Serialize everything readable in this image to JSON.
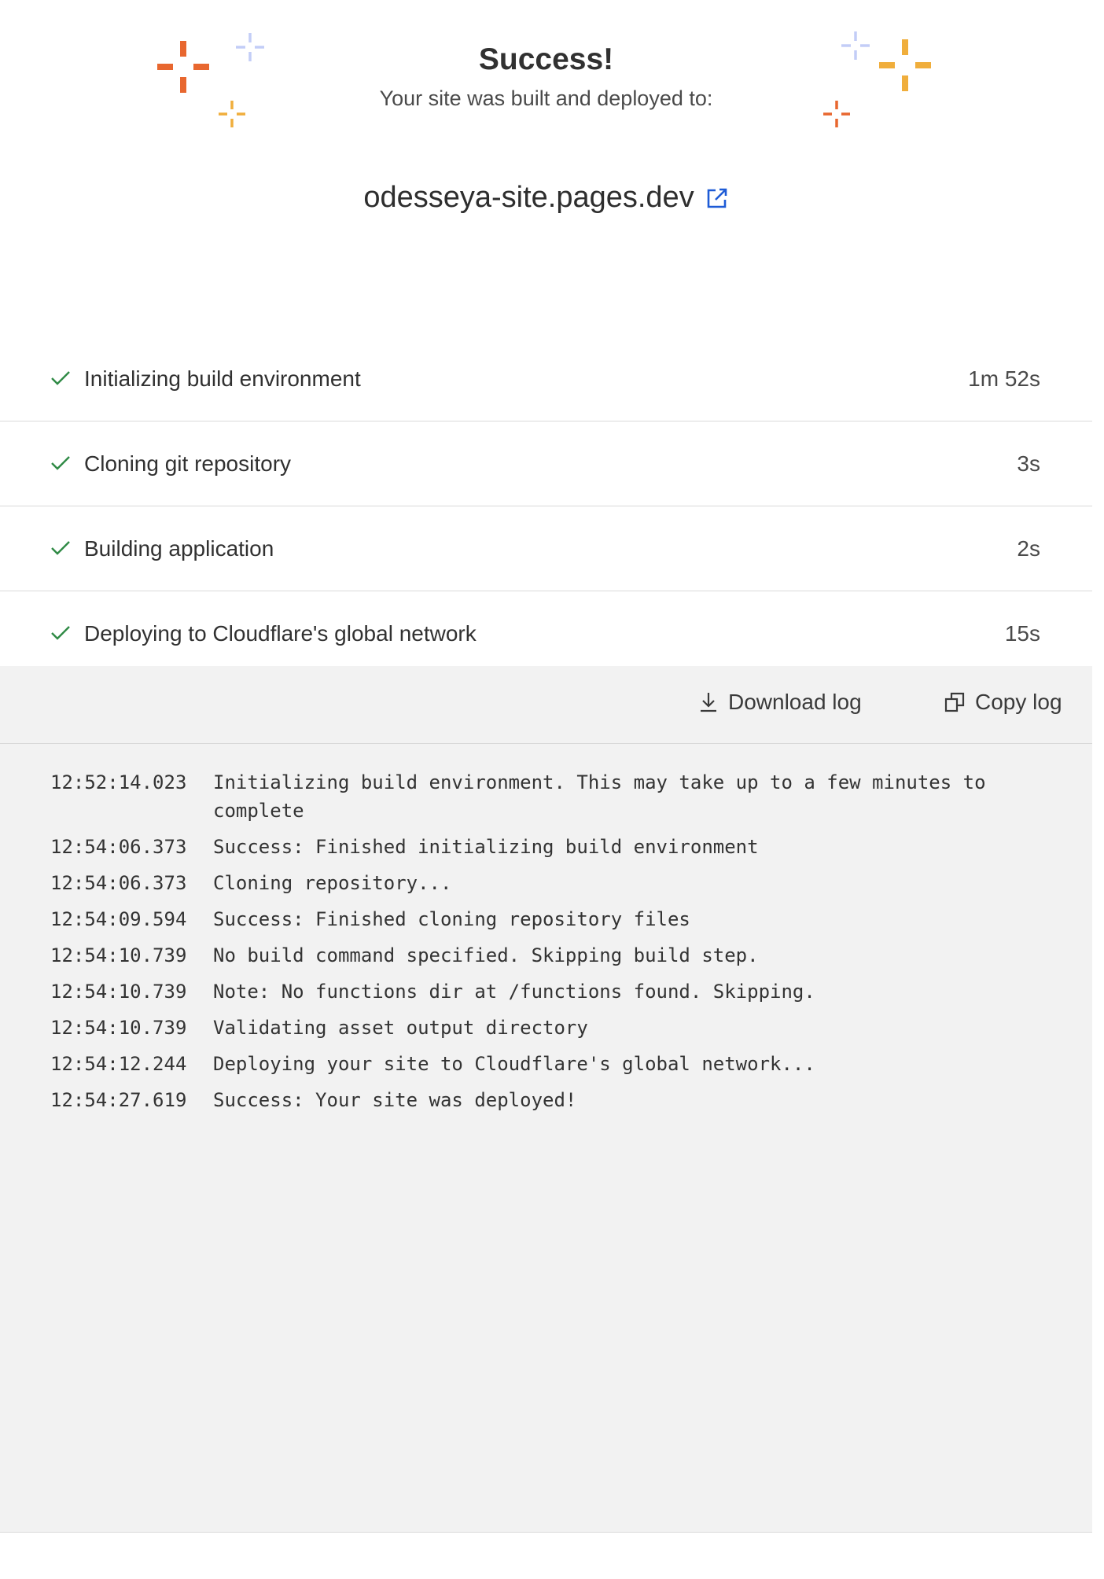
{
  "header": {
    "title": "Success!",
    "subtitle": "Your site was built and deployed to:",
    "site_url": "odesseya-site.pages.dev",
    "colors": {
      "orange": "#e8672f",
      "yellow": "#f0ae3c",
      "light_blue": "#c3cdf7",
      "link_icon": "#1e5bd6"
    }
  },
  "steps": [
    {
      "label": "Initializing build environment",
      "duration": "1m 52s",
      "status": "success"
    },
    {
      "label": "Cloning git repository",
      "duration": "3s",
      "status": "success"
    },
    {
      "label": "Building application",
      "duration": "2s",
      "status": "success"
    },
    {
      "label": "Deploying to Cloudflare's global network",
      "duration": "15s",
      "status": "success"
    }
  ],
  "toolbar": {
    "download_label": "Download log",
    "copy_label": "Copy log"
  },
  "log": [
    {
      "time": "12:52:14.023",
      "message": "Initializing build environment. This may take up to a few minutes to complete"
    },
    {
      "time": "12:54:06.373",
      "message": "Success: Finished initializing build environment"
    },
    {
      "time": "12:54:06.373",
      "message": "Cloning repository..."
    },
    {
      "time": "12:54:09.594",
      "message": "Success: Finished cloning repository files"
    },
    {
      "time": "12:54:10.739",
      "message": "No build command specified. Skipping build step."
    },
    {
      "time": "12:54:10.739",
      "message": "Note: No functions dir at /functions found. Skipping."
    },
    {
      "time": "12:54:10.739",
      "message": "Validating asset output directory"
    },
    {
      "time": "12:54:12.244",
      "message": "Deploying your site to Cloudflare's global network..."
    },
    {
      "time": "12:54:27.619",
      "message": "Success: Your site was deployed!"
    }
  ]
}
